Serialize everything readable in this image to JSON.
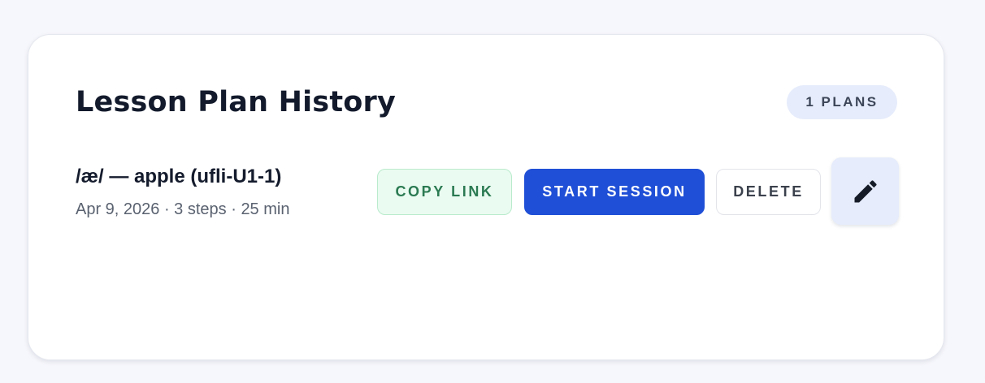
{
  "history": {
    "title": "Lesson Plan History",
    "count_badge": "1 PLANS"
  },
  "plans": [
    {
      "title": "/æ/ — apple (ufli-U1-1)",
      "meta": "Apr 9, 2026 · 3 steps · 25 min",
      "actions": {
        "copy_link": "COPY LINK",
        "start_session": "START SESSION",
        "delete": "DELETE",
        "edit_icon": "pencil-icon"
      }
    }
  ],
  "colors": {
    "background": "#f6f7fc",
    "card": "#ffffff",
    "primary": "#1f4fd6",
    "copy_bg": "#eafbf1",
    "copy_text": "#2b7a52",
    "badge_bg": "#e6ecfb",
    "title_text": "#121a2b",
    "meta_text": "#5a6270"
  }
}
